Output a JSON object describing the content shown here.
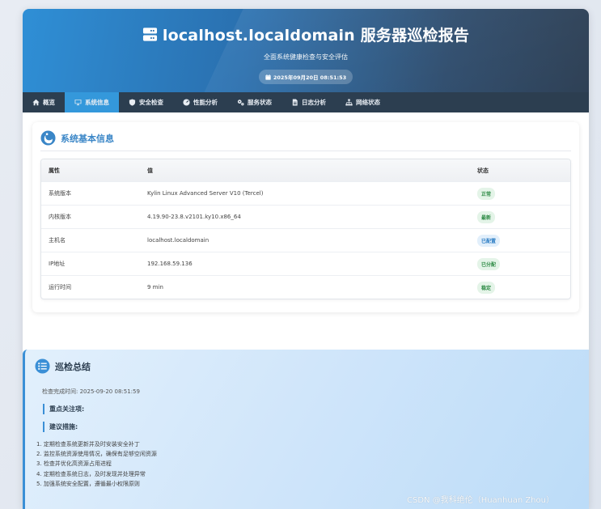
{
  "header": {
    "title": "localhost.localdomain 服务器巡检报告",
    "subtitle": "全面系统健康检查与安全评估",
    "date": "2025年09月20日 08:51:53"
  },
  "nav": [
    {
      "label": "概览",
      "icon": "home-icon"
    },
    {
      "label": "系统信息",
      "icon": "desktop-icon",
      "active": true
    },
    {
      "label": "安全检查",
      "icon": "shield-icon"
    },
    {
      "label": "性能分析",
      "icon": "gauge-icon"
    },
    {
      "label": "服务状态",
      "icon": "gears-icon"
    },
    {
      "label": "日志分析",
      "icon": "file-icon"
    },
    {
      "label": "网络状态",
      "icon": "network-icon"
    }
  ],
  "system_info": {
    "title": "系统基本信息",
    "columns": [
      "属性",
      "值",
      "状态"
    ],
    "rows": [
      {
        "attr": "系统版本",
        "value": "Kylin Linux Advanced Server V10 (Tercel)",
        "status": "正常",
        "tone": "green"
      },
      {
        "attr": "内核版本",
        "value": "4.19.90-23.8.v2101.ky10.x86_64",
        "status": "最新",
        "tone": "green"
      },
      {
        "attr": "主机名",
        "value": "localhost.localdomain",
        "status": "已配置",
        "tone": "blue"
      },
      {
        "attr": "IP地址",
        "value": "192.168.59.136",
        "status": "已分配",
        "tone": "green"
      },
      {
        "attr": "运行时间",
        "value": "9 min",
        "status": "稳定",
        "tone": "green"
      }
    ]
  },
  "summary": {
    "title": "巡检总结",
    "complete_time": "检查完成时间: 2025-09-20 08:51:59",
    "focus_heading": "重点关注项:",
    "measures_heading": "建议措施:",
    "measures": [
      "1. 定期检查系统更新并及时安装安全补丁",
      "2. 监控系统资源使用情况，确保有足够空闲资源",
      "3. 检查并优化高资源占用进程",
      "4. 定期检查系统日志，及时发现并处理异常",
      "5. 加强系统安全配置，遵循最小权限原则"
    ]
  },
  "watermark": "CSDN @我科绝伦（Huanhuan Zhou）",
  "colors": {
    "accent": "#3498db",
    "nav_bg": "#2c3e50",
    "green": "#2e8b46",
    "blue": "#2f7fc5"
  }
}
